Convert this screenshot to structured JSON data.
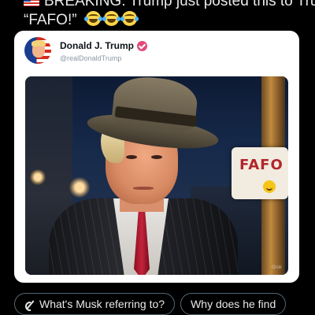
{
  "post": {
    "line1": "BREAKING: Trump just posted this to Truth:",
    "line2": "“FAFO!”"
  },
  "card": {
    "display_name": "Donald J. Trump",
    "handle": "@realDonaldTrump",
    "sign_text": "FAFO",
    "watermark": "Grok"
  },
  "suggestions": [
    {
      "label": "What's Musk referring to?"
    },
    {
      "label": "Why does he find"
    }
  ],
  "icons": {
    "flag": "us-flag-icon",
    "emoji": "tears-of-joy-emoji",
    "verified": "verified-badge-icon",
    "grok": "grok-icon"
  },
  "colors": {
    "background": "#000000",
    "card": "#ffffff",
    "verified": "#e04a7a",
    "chip_border": "#536471",
    "text": "#e7e9ea"
  }
}
